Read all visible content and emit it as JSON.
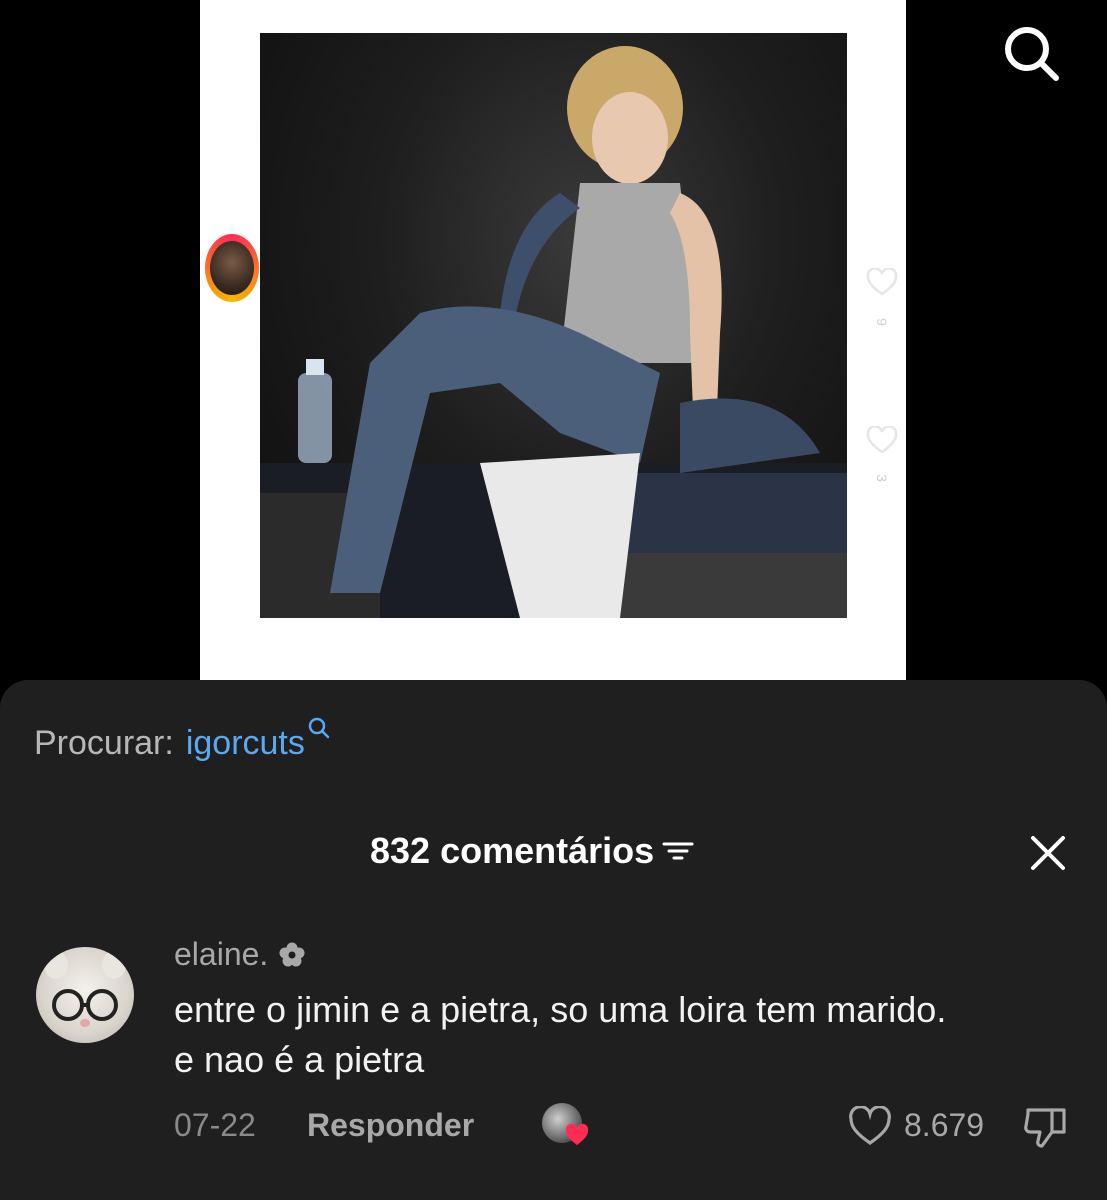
{
  "video": {
    "side_counts": [
      "9",
      "3"
    ]
  },
  "icons": {
    "top_search": "search-icon",
    "sort": "sort-icon",
    "close": "close-icon",
    "like": "heart-icon",
    "dislike": "dislike-icon",
    "verified": "flower-icon"
  },
  "comments_sheet": {
    "search_prefix": "Procurar:",
    "search_term": "igorcuts",
    "count_label": "832 comentários",
    "comment": {
      "username": "elaine.",
      "text": "entre o jimin e a pietra, so uma loira tem marido. e nao é a pietra",
      "date": "07-22",
      "reply_label": "Responder",
      "like_count": "8.679"
    }
  },
  "colors": {
    "sheet_bg": "#1f1f1f",
    "link_blue": "#5aa9f0",
    "creator_heart": "#fe2c55"
  }
}
